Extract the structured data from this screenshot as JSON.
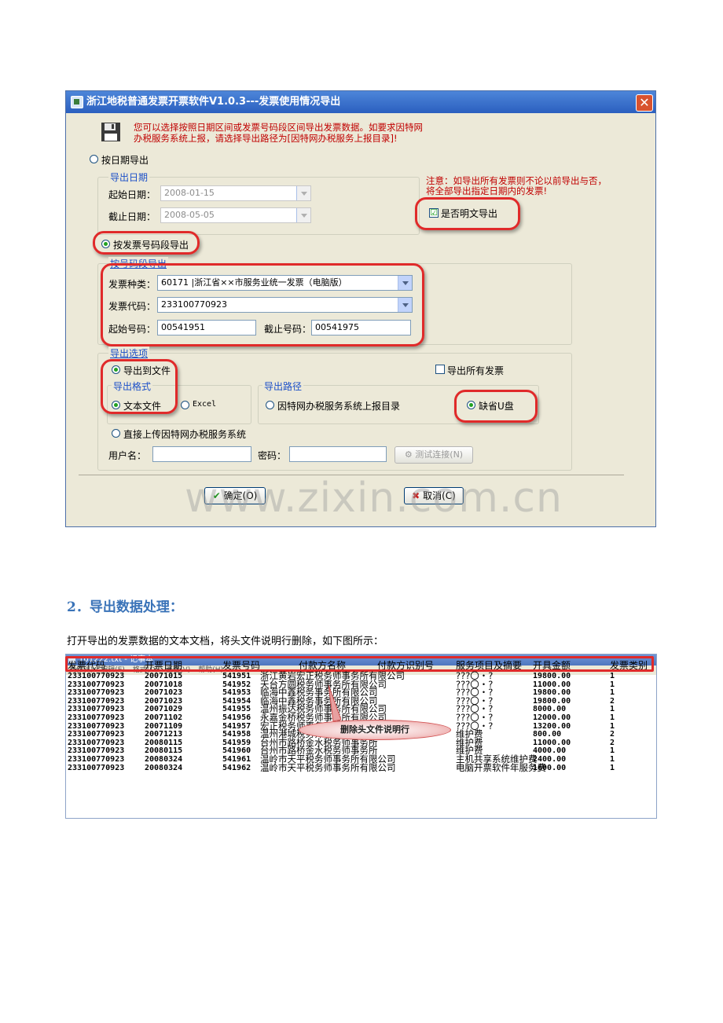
{
  "dialog": {
    "title": "浙江地税普通发票开票软件V1.0.3---发票使用情况导出",
    "close_glyph": "✕",
    "intro": [
      "您可以选择按照日期区间或发票号码段区间导出发票数据。如要求因特网",
      "办税服务系统上报，请选择导出路径为[因特网办税服务上报目录]!"
    ],
    "date_mode_label": "按日期导出",
    "date_group_title": "导出日期",
    "start_date_label": "起始日期：",
    "start_date_value": "2008-01-15",
    "end_date_label": "截止日期：",
    "end_date_value": "2008-05-05",
    "notice": [
      "注意：如导出所有发票则不论以前导出与否，",
      "将全部导出指定日期内的发票!"
    ],
    "plaintext_label": "是否明文导出",
    "plaintext_checked": "☑",
    "number_mode_label": "按发票号码段导出",
    "number_group_title": "按号码段导出",
    "invoice_type_label": "发票种类：",
    "invoice_type_value": "60171 |浙江省××市服务业统一发票（电脑版）",
    "invoice_code_label": "发票代码：",
    "invoice_code_value": "233100770923",
    "start_no_label": "起始号码：",
    "start_no_value": "00541951",
    "end_no_label": "截止号码：",
    "end_no_value": "00541975",
    "options_group_title": "导出选项",
    "export_file_label": "导出到文件",
    "export_all_label": "导出所有发票",
    "format_group_title": "导出格式",
    "format_text_label": "文本文件",
    "format_excel_label": "Excel",
    "path_group_title": "导出路径",
    "path_internet_label": "因特网办税服务系统上报目录",
    "path_default_label": "缺省U盘",
    "upload_label": "直接上传因特网办税服务系统",
    "username_label": "用户名：",
    "password_label": "密码：",
    "test_button": "测试连接(N)",
    "ok_button": "确定(O)",
    "cancel_button": "取消(C)"
  },
  "watermark": "www.zixin.com.cn",
  "section_heading": "2．导出数据处理：",
  "paragraph": "打开导出的发票数据的文本文档，将头文件说明行删除，如下图所示：",
  "notepad": {
    "title": "101222.txt - 记事本",
    "menu": [
      "文件(F)",
      "编辑(E)",
      "格式(O)",
      "查看(V)",
      "帮助(H)"
    ],
    "headers": [
      "发票代码",
      "开票日期",
      "发票号码",
      "付款方名称",
      "付款方识别号",
      "服务项目及摘要",
      "开具金额",
      "发票类别"
    ],
    "callout": "删除头文件说明行",
    "rows": [
      {
        "code": "233100770923",
        "date": "20071015",
        "no": "541951",
        "payer": "浙江黄岩宏正税务师事务所有限公司",
        "item": "???〇・?",
        "amount": "19800.00",
        "type": "1"
      },
      {
        "code": "233100770923",
        "date": "20071018",
        "no": "541952",
        "payer": "天台方圆税务师事务所有限公司",
        "item": "???〇・?",
        "amount": "11000.00",
        "type": "1"
      },
      {
        "code": "233100770923",
        "date": "20071023",
        "no": "541953",
        "payer": "临海中鑫税务事务所有限公司",
        "item": "???〇・?",
        "amount": "19800.00",
        "type": "1"
      },
      {
        "code": "233100770923",
        "date": "20071023",
        "no": "541954",
        "payer": "临海中鑫税务事务所有限公司",
        "item": "???〇・?",
        "amount": "19800.00",
        "type": "2"
      },
      {
        "code": "233100770923",
        "date": "20071029",
        "no": "541955",
        "payer": "温州振达税务师事务所有限公司",
        "item": "???〇・?",
        "amount": "8000.00",
        "type": "1"
      },
      {
        "code": "233100770923",
        "date": "20071102",
        "no": "541956",
        "payer": "永嘉金桥税务师事务所有限公司",
        "item": "???〇・?",
        "amount": "12000.00",
        "type": "1"
      },
      {
        "code": "233100770923",
        "date": "20071109",
        "no": "541957",
        "payer": "宏正税务师事务所椒江分所",
        "item": "???〇・?",
        "amount": "13200.00",
        "type": "1"
      },
      {
        "code": "233100770923",
        "date": "20071213",
        "no": "541958",
        "payer": "温州港城税务师事务所有限公司",
        "item": "维护费",
        "amount": "800.00",
        "type": "2"
      },
      {
        "code": "233100770923",
        "date": "20080115",
        "no": "541959",
        "payer": "台州市路桥金水税务师事务所",
        "item": "维护费",
        "amount": "11000.00",
        "type": "2"
      },
      {
        "code": "233100770923",
        "date": "20080115",
        "no": "541960",
        "payer": "台州市路桥金水税务师事务所",
        "item": "维护费",
        "amount": "4000.00",
        "type": "1"
      },
      {
        "code": "233100770923",
        "date": "20080324",
        "no": "541961",
        "payer": "温岭市天平税务师事务所有限公司",
        "item": "主机共享系统维护费",
        "amount": "2400.00",
        "type": "1"
      },
      {
        "code": "233100770923",
        "date": "20080324",
        "no": "541962",
        "payer": "温岭市天平税务师事务所有限公司",
        "item": "电脑开票软件年服务费",
        "amount": "1600.00",
        "type": "1"
      }
    ]
  },
  "colors": {
    "highlight": "#e02a2a",
    "heading": "#3a73b8",
    "title_bar": "#2b5fbf"
  }
}
